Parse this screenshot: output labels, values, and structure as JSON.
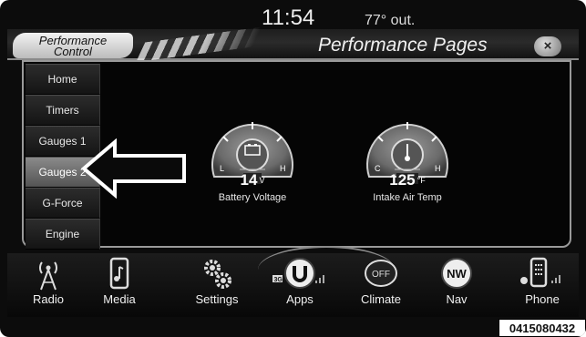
{
  "status": {
    "time": "11:54",
    "temperature": "77° out."
  },
  "header": {
    "logo_line1": "Performance",
    "logo_line2": "Control",
    "title": "Performance Pages",
    "close_label": "×"
  },
  "menu": {
    "items": [
      {
        "label": "Home"
      },
      {
        "label": "Timers"
      },
      {
        "label": "Gauges 1"
      },
      {
        "label": "Gauges 2"
      },
      {
        "label": "G-Force"
      },
      {
        "label": "Engine"
      }
    ],
    "active": "Gauges 2"
  },
  "gauges": [
    {
      "name": "Battery Voltage",
      "value": "14",
      "unit": "V",
      "low": "L",
      "high": "H",
      "icon": "battery-icon"
    },
    {
      "name": "Intake Air Temp",
      "value": "125",
      "unit": "°F",
      "low": "C",
      "high": "H",
      "icon": "temperature-icon"
    }
  ],
  "bottom_nav": [
    {
      "label": "Radio",
      "icon": "radio-tower-icon"
    },
    {
      "label": "Media",
      "icon": "media-phone-icon"
    },
    {
      "label": "Settings",
      "icon": "gears-icon"
    },
    {
      "label": "Apps",
      "icon": "uconnect-icon",
      "badge": "3G"
    },
    {
      "label": "Climate",
      "icon": "off-button-icon",
      "icon_text": "OFF"
    },
    {
      "label": "Nav",
      "icon": "compass-icon",
      "icon_text": "NW"
    },
    {
      "label": "Phone",
      "icon": "phone-keypad-icon"
    }
  ],
  "figure_code": "0415080432",
  "colors": {
    "background": "#0c0c0c",
    "active_tab": "#6e6e6e",
    "border": "#9a9a9a"
  }
}
